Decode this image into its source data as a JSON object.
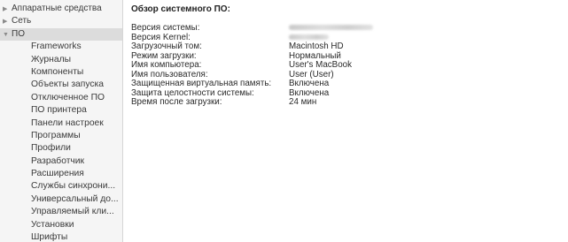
{
  "sidebar": {
    "items": [
      {
        "label": "Аппаратные средства",
        "level": 0,
        "expanded": false,
        "selected": false
      },
      {
        "label": "Сеть",
        "level": 0,
        "expanded": false,
        "selected": false
      },
      {
        "label": "ПО",
        "level": 0,
        "expanded": true,
        "selected": true
      },
      {
        "label": "Frameworks",
        "level": 1
      },
      {
        "label": "Журналы",
        "level": 1
      },
      {
        "label": "Компоненты",
        "level": 1
      },
      {
        "label": "Объекты запуска",
        "level": 1
      },
      {
        "label": "Отключенное ПО",
        "level": 1
      },
      {
        "label": "ПО принтера",
        "level": 1
      },
      {
        "label": "Панели настроек",
        "level": 1
      },
      {
        "label": "Программы",
        "level": 1
      },
      {
        "label": "Профили",
        "level": 1
      },
      {
        "label": "Разработчик",
        "level": 1
      },
      {
        "label": "Расширения",
        "level": 1
      },
      {
        "label": "Службы синхрони...",
        "level": 1
      },
      {
        "label": "Универсальный до...",
        "level": 1
      },
      {
        "label": "Управляемый кли...",
        "level": 1
      },
      {
        "label": "Установки",
        "level": 1
      },
      {
        "label": "Шрифты",
        "level": 1
      }
    ],
    "icons": {
      "collapsed": "disclosure-triangle-right",
      "expanded": "disclosure-triangle-down"
    }
  },
  "main": {
    "title": "Обзор системного ПО:",
    "rows": [
      {
        "label": "Версия системы:",
        "value": "",
        "value_blurred": true
      },
      {
        "label": "Версия Kernel:",
        "value": "",
        "value_blurred": true
      },
      {
        "label": "Загрузочный том:",
        "value": "Macintosh HD"
      },
      {
        "label": "Режим загрузки:",
        "value": "Нормальный"
      },
      {
        "label": "Имя компьютера:",
        "value": "User's MacBook"
      },
      {
        "label": "Имя пользователя:",
        "value": "User (User)"
      },
      {
        "label": "Защищенная виртуальная память:",
        "value": "Включена"
      },
      {
        "label": "Защита целостности системы:",
        "value": "Включена"
      },
      {
        "label": "Время после загрузки:",
        "value": "24 мин"
      }
    ]
  }
}
